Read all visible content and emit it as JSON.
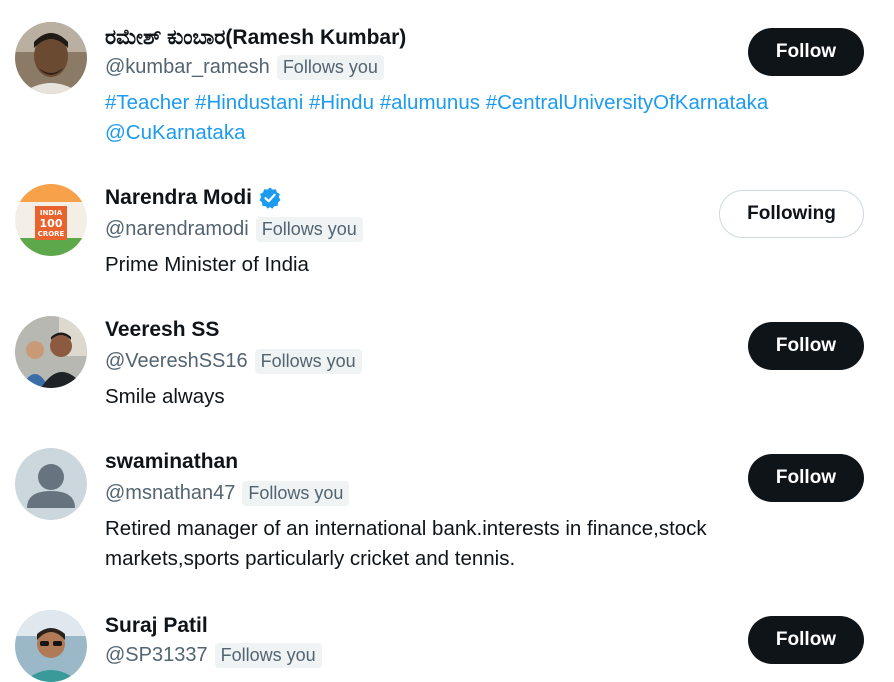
{
  "users": [
    {
      "name": "ರಮೇಶ್ ಕುಂಬಾರ(Ramesh Kumbar)",
      "handle": "@kumbar_ramesh",
      "badge": "Follows you",
      "bio_tags": [
        "#Teacher",
        "#Hindustani",
        "#Hindu",
        "#alumunus",
        "#CentralUniversityOfKarnataka",
        "@CuKarnataka"
      ],
      "button": "Follow"
    },
    {
      "name": "Narendra Modi",
      "handle": "@narendramodi",
      "badge": "Follows you",
      "bio": "Prime Minister of India",
      "button": "Following",
      "verified": true,
      "avatar_text": [
        "INDIA",
        "100",
        "CRORE"
      ]
    },
    {
      "name": "Veeresh SS",
      "handle": "@VeereshSS16",
      "badge": "Follows you",
      "bio": "Smile always",
      "button": "Follow"
    },
    {
      "name": "swaminathan",
      "handle": "@msnathan47",
      "badge": "Follows you",
      "bio_lines": [
        "Retired manager of an international bank.interests in finance,stock",
        "markets,sports particularly cricket and tennis."
      ],
      "button": "Follow"
    },
    {
      "name": "Suraj Patil",
      "handle": "@SP31337",
      "badge": "Follows you",
      "button": "Follow"
    }
  ],
  "colors": {
    "link": "#1d9bf0",
    "text": "#0f1419",
    "muted": "#536471",
    "button_dark": "#0f1419"
  }
}
